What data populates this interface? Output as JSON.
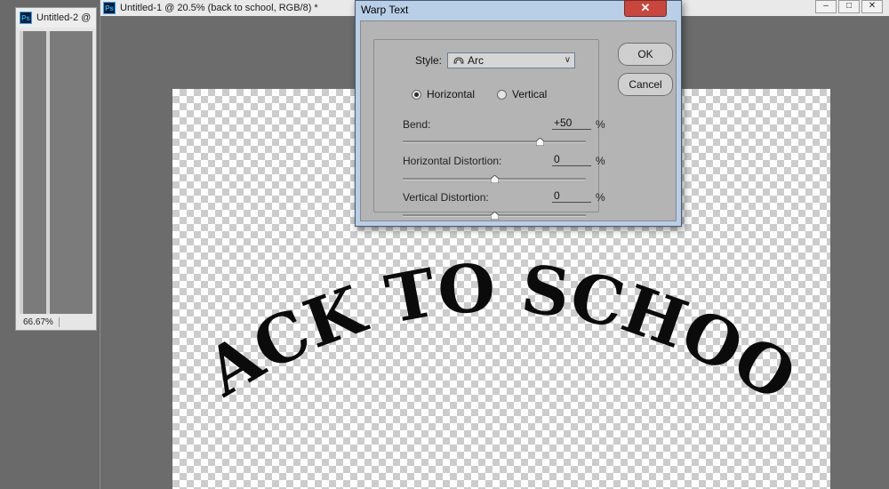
{
  "window2": {
    "ps_badge": "Ps",
    "title": "Untitled-2 @",
    "zoom": "66.67%"
  },
  "main_window": {
    "ps_badge": "Ps",
    "title": "Untitled-1 @ 20.5% (back to school, RGB/8) *",
    "controls": {
      "minimize": "–",
      "restore": "□",
      "close": "✕"
    }
  },
  "canvas": {
    "warped_text": "BACK TO SCHOOL"
  },
  "dialog": {
    "title": "Warp Text",
    "close": "✕",
    "style_label": "Style:",
    "style_value": "Arc",
    "orientation": {
      "horizontal": "Horizontal",
      "vertical": "Vertical",
      "selected": "horizontal"
    },
    "params": [
      {
        "label": "Bend:",
        "value": "+50",
        "unit": "%",
        "percent": 50
      },
      {
        "label": "Horizontal Distortion:",
        "value": "0",
        "unit": "%",
        "percent": 0
      },
      {
        "label": "Vertical Distortion:",
        "value": "0",
        "unit": "%",
        "percent": 0
      }
    ],
    "ok": "OK",
    "cancel": "Cancel"
  },
  "colors": {
    "workspace": "#6a6a6a",
    "dialog_frame": "#b9cfe8",
    "dialog_body": "#b4b4b4",
    "close_red": "#c9463d",
    "text_fill": "#0b0b0b"
  }
}
